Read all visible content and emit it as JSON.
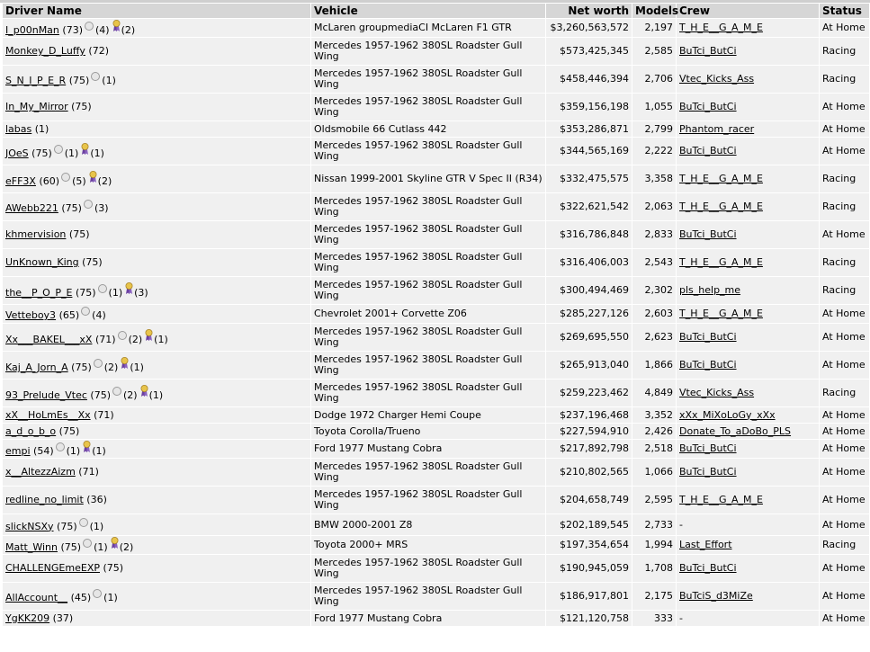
{
  "headers": {
    "driver": "Driver Name",
    "vehicle": "Vehicle",
    "networth": "Net worth",
    "models": "Models",
    "crew": "Crew",
    "status": "Status"
  },
  "rows": [
    {
      "name": "I_p00nMan",
      "level": "(73)",
      "pts": "(4)",
      "ribbon": true,
      "ribbon_count": "(2)",
      "vehicle": "McLaren groupmediaCI McLaren F1 GTR",
      "networth": "$3,260,563,572",
      "models": "2,197",
      "crew": "T_H_E__G_A_M_E",
      "crew_link": true,
      "status": "At Home"
    },
    {
      "name": "Monkey_D_Luffy",
      "level": "(72)",
      "pts": "",
      "ribbon": false,
      "ribbon_count": "",
      "vehicle": "Mercedes 1957-1962 380SL Roadster Gull Wing",
      "networth": "$573,425,345",
      "models": "2,585",
      "crew": "BuTci_ButCi",
      "crew_link": true,
      "status": "Racing"
    },
    {
      "name": "S_N_I_P_E_R",
      "level": "(75)",
      "pts": "(1)",
      "ribbon": false,
      "ribbon_count": "",
      "vehicle": "Mercedes 1957-1962 380SL Roadster Gull Wing",
      "networth": "$458,446,394",
      "models": "2,706",
      "crew": "Vtec_Kicks_Ass",
      "crew_link": true,
      "status": "Racing"
    },
    {
      "name": "In_My_Mirror",
      "level": "(75)",
      "pts": "",
      "ribbon": false,
      "ribbon_count": "",
      "vehicle": "Mercedes 1957-1962 380SL Roadster Gull Wing",
      "networth": "$359,156,198",
      "models": "1,055",
      "crew": "BuTci_ButCi",
      "crew_link": true,
      "status": "At Home"
    },
    {
      "name": "labas",
      "level": "(1)",
      "pts": "",
      "ribbon": false,
      "ribbon_count": "",
      "vehicle": "Oldsmobile 66 Cutlass 442",
      "networth": "$353,286,871",
      "models": "2,799",
      "crew": "Phantom_racer",
      "crew_link": true,
      "status": "At Home"
    },
    {
      "name": "JOeS",
      "level": "(75)",
      "pts": "(1)",
      "ribbon": true,
      "ribbon_count": "(1)",
      "vehicle": "Mercedes 1957-1962 380SL Roadster Gull Wing",
      "networth": "$344,565,169",
      "models": "2,222",
      "crew": "BuTci_ButCi",
      "crew_link": true,
      "status": "At Home"
    },
    {
      "name": "eFF3X",
      "level": "(60)",
      "pts": "(5)",
      "ribbon": true,
      "ribbon_count": "(2)",
      "vehicle": "Nissan 1999-2001 Skyline GTR V Spec II (R34)",
      "networth": "$332,475,575",
      "models": "3,358",
      "crew": "T_H_E__G_A_M_E",
      "crew_link": true,
      "status": "Racing"
    },
    {
      "name": "AWebb221",
      "level": "(75)",
      "pts": "(3)",
      "ribbon": false,
      "ribbon_count": "",
      "vehicle": "Mercedes 1957-1962 380SL Roadster Gull Wing",
      "networth": "$322,621,542",
      "models": "2,063",
      "crew": "T_H_E__G_A_M_E",
      "crew_link": true,
      "status": "Racing"
    },
    {
      "name": "khmervision",
      "level": "(75)",
      "pts": "",
      "ribbon": false,
      "ribbon_count": "",
      "vehicle": "Mercedes 1957-1962 380SL Roadster Gull Wing",
      "networth": "$316,786,848",
      "models": "2,833",
      "crew": "BuTci_ButCi",
      "crew_link": true,
      "status": "At Home"
    },
    {
      "name": "UnKnown_King",
      "level": "(75)",
      "pts": "",
      "ribbon": false,
      "ribbon_count": "",
      "vehicle": "Mercedes 1957-1962 380SL Roadster Gull Wing",
      "networth": "$316,406,003",
      "models": "2,543",
      "crew": "T_H_E__G_A_M_E",
      "crew_link": true,
      "status": "Racing"
    },
    {
      "name": "the__P_O_P_E",
      "level": "(75)",
      "pts": "(1)",
      "ribbon": true,
      "ribbon_count": "(3)",
      "vehicle": "Mercedes 1957-1962 380SL Roadster Gull Wing",
      "networth": "$300,494,469",
      "models": "2,302",
      "crew": "pls_help_me",
      "crew_link": true,
      "status": "Racing"
    },
    {
      "name": "Vetteboy3",
      "level": "(65)",
      "pts": "(4)",
      "ribbon": false,
      "ribbon_count": "",
      "vehicle": "Chevrolet 2001+ Corvette Z06",
      "networth": "$285,227,126",
      "models": "2,603",
      "crew": "T_H_E__G_A_M_E",
      "crew_link": true,
      "status": "At Home"
    },
    {
      "name": "Xx___BAKEL___xX",
      "level": "(71)",
      "pts": "(2)",
      "ribbon": true,
      "ribbon_count": "(1)",
      "vehicle": "Mercedes 1957-1962 380SL Roadster Gull Wing",
      "networth": "$269,695,550",
      "models": "2,623",
      "crew": "BuTci_ButCi",
      "crew_link": true,
      "status": "At Home"
    },
    {
      "name": "Kaj_A_Jorn_A",
      "level": "(75)",
      "pts": "(2)",
      "ribbon": true,
      "ribbon_count": "(1)",
      "vehicle": "Mercedes 1957-1962 380SL Roadster Gull Wing",
      "networth": "$265,913,040",
      "models": "1,866",
      "crew": "BuTci_ButCi",
      "crew_link": true,
      "status": "At Home"
    },
    {
      "name": "93_Prelude_Vtec",
      "level": "(75)",
      "pts": "(2)",
      "ribbon": true,
      "ribbon_count": "(1)",
      "vehicle": "Mercedes 1957-1962 380SL Roadster Gull Wing",
      "networth": "$259,223,462",
      "models": "4,849",
      "crew": "Vtec_Kicks_Ass",
      "crew_link": true,
      "status": "Racing"
    },
    {
      "name": "xX__HoLmEs__Xx",
      "level": "(71)",
      "pts": "",
      "ribbon": false,
      "ribbon_count": "",
      "vehicle": "Dodge 1972 Charger Hemi Coupe",
      "networth": "$237,196,468",
      "models": "3,352",
      "crew": "xXx_MiXoLoGy_xXx",
      "crew_link": true,
      "status": "At Home"
    },
    {
      "name": "a_d_o_b_o",
      "level": "(75)",
      "pts": "",
      "ribbon": false,
      "ribbon_count": "",
      "vehicle": "Toyota Corolla/Trueno",
      "networth": "$227,594,910",
      "models": "2,426",
      "crew": "Donate_To_aDoBo_PLS",
      "crew_link": true,
      "status": "At Home"
    },
    {
      "name": "empi",
      "level": "(54)",
      "pts": "(1)",
      "ribbon": true,
      "ribbon_count": "(1)",
      "vehicle": "Ford 1977 Mustang Cobra",
      "networth": "$217,892,798",
      "models": "2,518",
      "crew": "BuTci_ButCi",
      "crew_link": true,
      "status": "At Home"
    },
    {
      "name": "x__AltezzAizm",
      "level": "(71)",
      "pts": "",
      "ribbon": false,
      "ribbon_count": "",
      "vehicle": "Mercedes 1957-1962 380SL Roadster Gull Wing",
      "networth": "$210,802,565",
      "models": "1,066",
      "crew": "BuTci_ButCi",
      "crew_link": true,
      "status": "At Home"
    },
    {
      "name": "redline_no_limit",
      "level": "(36)",
      "pts": "",
      "ribbon": false,
      "ribbon_count": "",
      "vehicle": "Mercedes 1957-1962 380SL Roadster Gull Wing",
      "networth": "$204,658,749",
      "models": "2,595",
      "crew": "T_H_E__G_A_M_E",
      "crew_link": true,
      "status": "At Home"
    },
    {
      "name": "slickNSXy",
      "level": "(75)",
      "pts": "(1)",
      "ribbon": false,
      "ribbon_count": "",
      "vehicle": "BMW 2000-2001 Z8",
      "networth": "$202,189,545",
      "models": "2,733",
      "crew": "-",
      "crew_link": false,
      "status": "At Home"
    },
    {
      "name": "Matt_Winn",
      "level": "(75)",
      "pts": "(1)",
      "ribbon": true,
      "ribbon_count": "(2)",
      "vehicle": "Toyota 2000+ MRS",
      "networth": "$197,354,654",
      "models": "1,994",
      "crew": "Last_Effort",
      "crew_link": true,
      "status": "Racing"
    },
    {
      "name": "CHALLENGEmeEXP",
      "level": "(75)",
      "pts": "",
      "ribbon": false,
      "ribbon_count": "",
      "vehicle": "Mercedes 1957-1962 380SL Roadster Gull Wing",
      "networth": "$190,945,059",
      "models": "1,708",
      "crew": "BuTci_ButCi",
      "crew_link": true,
      "status": "At Home"
    },
    {
      "name": "AllAccount__",
      "level": "(45)",
      "pts": "(1)",
      "ribbon": false,
      "ribbon_count": "",
      "vehicle": "Mercedes 1957-1962 380SL Roadster Gull Wing",
      "networth": "$186,917,801",
      "models": "2,175",
      "crew": "BuTciS_d3MiZe",
      "crew_link": true,
      "status": "At Home"
    },
    {
      "name": "YgKK209",
      "level": "(37)",
      "pts": "",
      "ribbon": false,
      "ribbon_count": "",
      "vehicle": "Ford 1977 Mustang Cobra",
      "networth": "$121,120,758",
      "models": "333",
      "crew": "-",
      "crew_link": false,
      "status": "At Home"
    }
  ]
}
